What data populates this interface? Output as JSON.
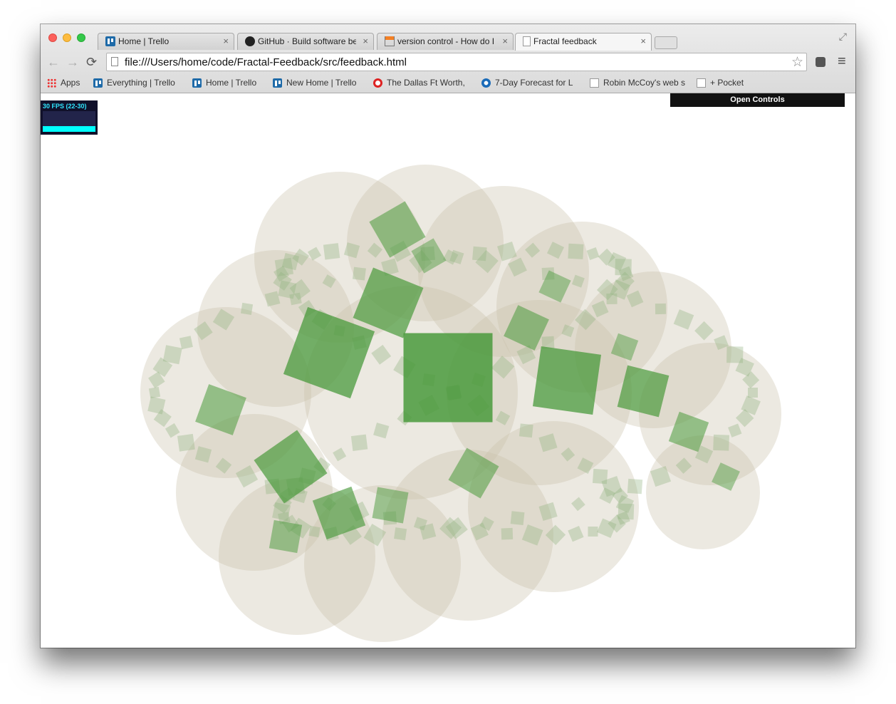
{
  "window": {
    "tabs": [
      {
        "label": "Home | Trello",
        "favicon": "trello-icon"
      },
      {
        "label": "GitHub · Build software be",
        "favicon": "github-icon"
      },
      {
        "label": "version control - How do I",
        "favicon": "stackoverflow-icon"
      },
      {
        "label": "Fractal feedback",
        "favicon": "document-icon",
        "active": true
      }
    ],
    "close_glyph": "×"
  },
  "toolbar": {
    "back": "←",
    "forward": "→",
    "reload": "⟳",
    "url": "file:///Users/home/code/Fractal-Feedback/src/feedback.html",
    "bookmark_star": "☆",
    "menu": "≡"
  },
  "bookmarks": [
    {
      "label": "Apps",
      "icon": "apps-grid-icon"
    },
    {
      "label": "Everything | Trello",
      "icon": "trello-icon"
    },
    {
      "label": "Home | Trello",
      "icon": "trello-icon"
    },
    {
      "label": "New Home | Trello",
      "icon": "trello-icon"
    },
    {
      "label": "The Dallas Ft Worth,",
      "icon": "gear-icon"
    },
    {
      "label": "7-Day Forecast for L",
      "icon": "noaa-icon"
    },
    {
      "label": "Robin McCoy's web s",
      "icon": "document-icon"
    },
    {
      "label": "+ Pocket",
      "icon": "document-icon"
    }
  ],
  "page": {
    "fps_label": "30 FPS (22-30)",
    "controls_button": "Open Controls"
  },
  "colors": {
    "square_green": "#4a9a3c",
    "fractal_beige": "#c8c0aa",
    "fps_cyan": "#00ffff"
  }
}
